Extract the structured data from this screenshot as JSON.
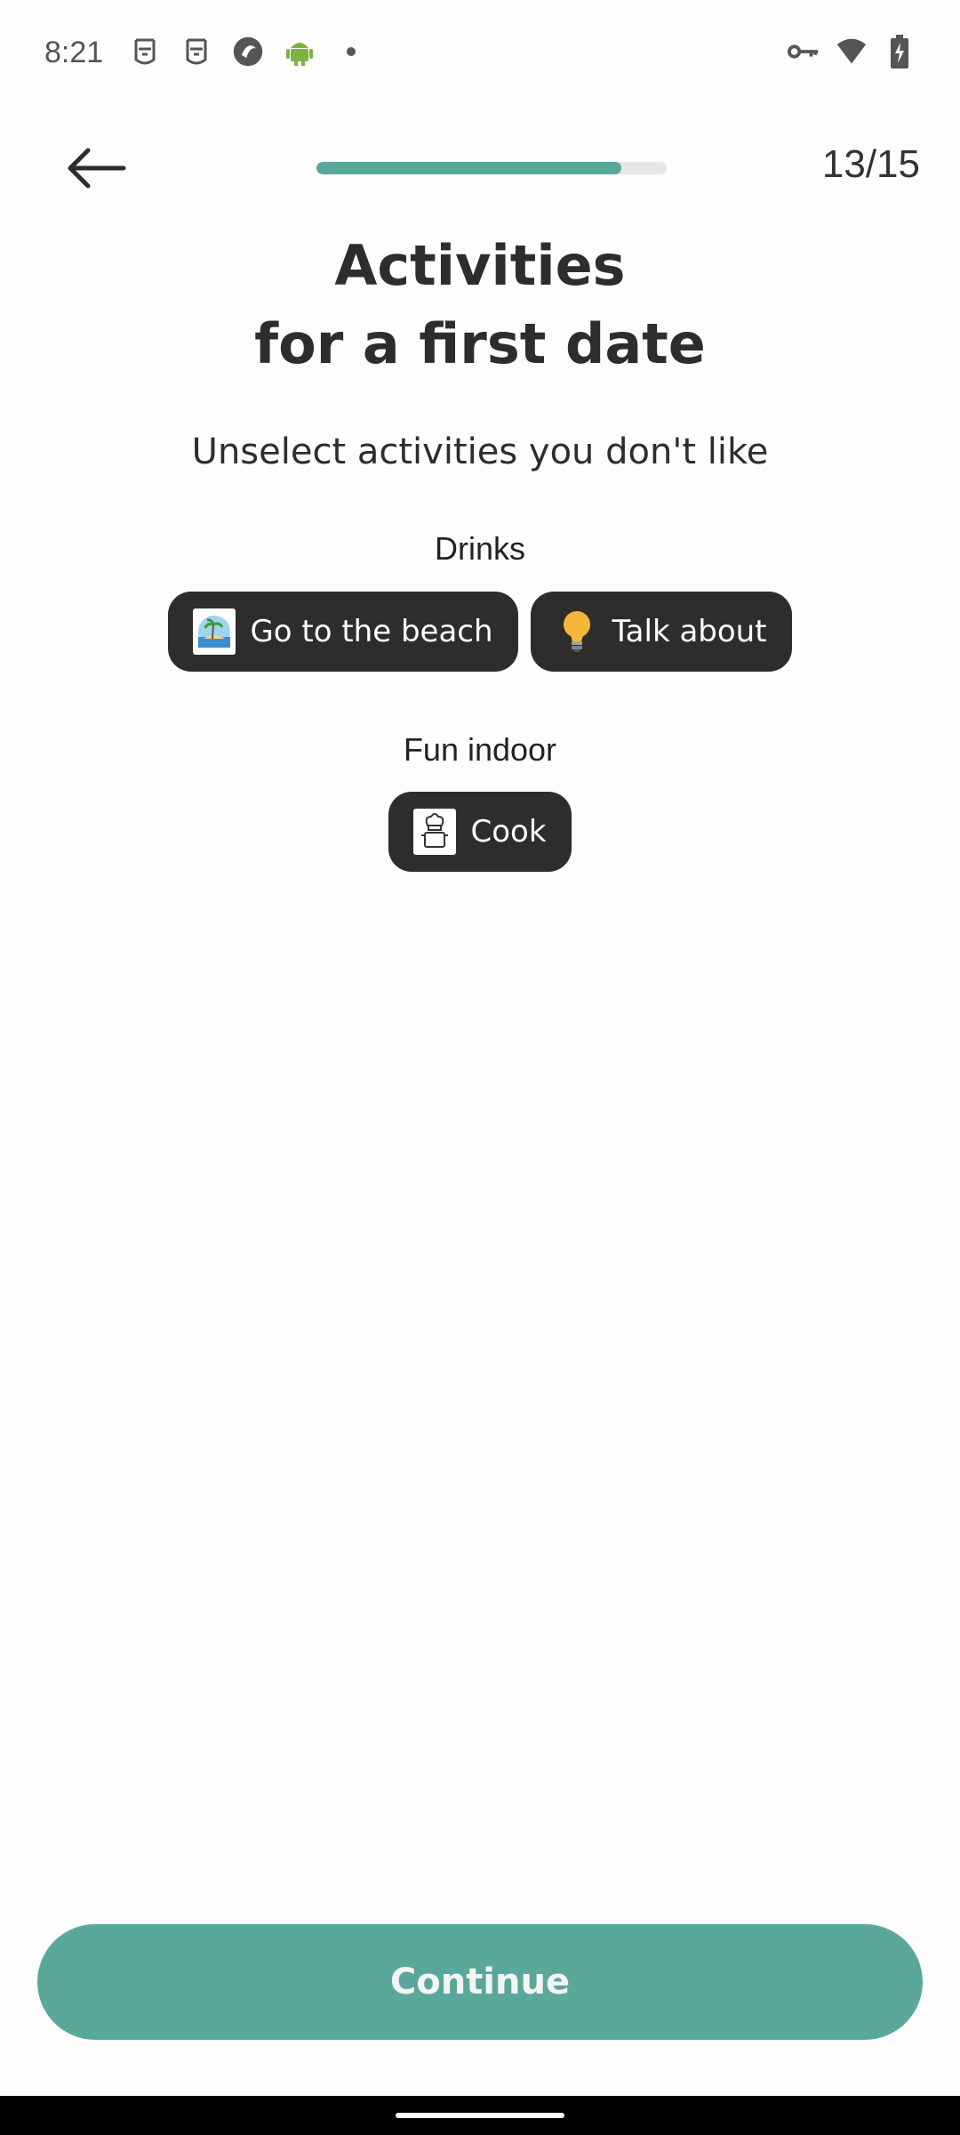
{
  "status_bar": {
    "time": "8:21",
    "left_icons": [
      "face-icon",
      "face-icon",
      "app-icon",
      "android-icon",
      "dot-icon"
    ],
    "right_icons": [
      "key-icon",
      "wifi-icon",
      "battery-charging-icon"
    ]
  },
  "header": {
    "back_icon": "arrow-left-icon",
    "progress": 0.87,
    "progress_color": "#5aa89a",
    "step": "13/15"
  },
  "title": {
    "line1": "Activities",
    "line2": "for a first date"
  },
  "subtitle": "Unselect activities you don't like",
  "sections": [
    {
      "label": "Drinks",
      "chips": [
        {
          "label": "Go to the beach",
          "icon": "beach-icon"
        },
        {
          "label": "Talk about",
          "icon": "lightbulb-icon"
        }
      ]
    },
    {
      "label": "Fun indoor",
      "chips": [
        {
          "label": "Cook",
          "icon": "chef-icon"
        }
      ]
    }
  ],
  "continue_label": "Continue",
  "colors": {
    "accent": "#5aa89a",
    "chip_bg": "#2f2d2c",
    "text": "#2f2d2c"
  }
}
